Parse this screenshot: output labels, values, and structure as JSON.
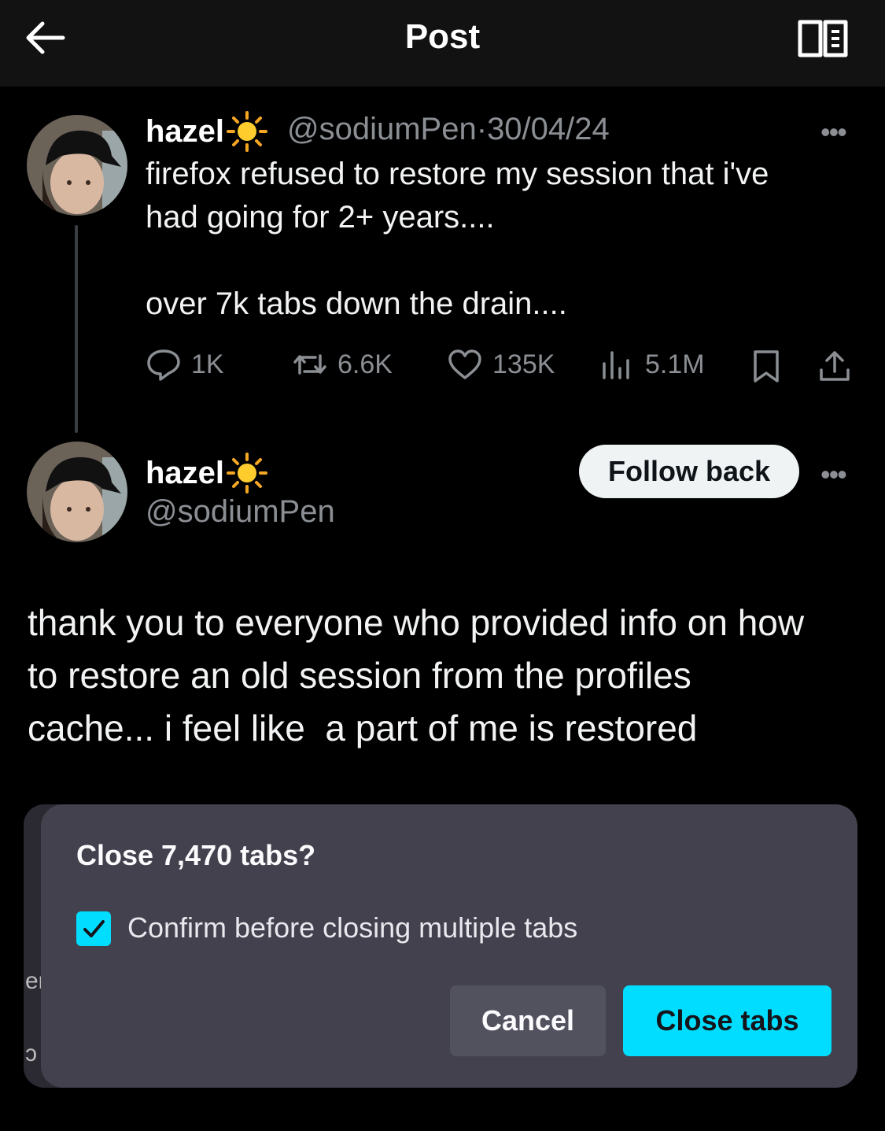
{
  "header": {
    "title": "Post",
    "back_icon": "back-arrow-icon",
    "reader_icon": "reader-mode-icon"
  },
  "colors": {
    "background": "#000000",
    "header": "#121212",
    "secondary_text": "#8b8f94",
    "dialog_bg": "#42414d",
    "accent": "#00ddff"
  },
  "tweet": {
    "name": "hazel",
    "emoji": "sun-icon",
    "handle": "@sodiumPen",
    "separator": "·",
    "date": "30/04/24",
    "more": "•••",
    "line1": "firefox refused to restore my session that i've",
    "line2": "had going for 2+ years....",
    "line3": "over 7k tabs down the drain....",
    "actions": {
      "replies": "1K",
      "reposts": "6.6K",
      "likes": "135K",
      "views": "5.1M"
    }
  },
  "reply": {
    "name": "hazel",
    "emoji": "sun-icon",
    "handle": "@sodiumPen",
    "follow_label": "Follow back",
    "more": "•••",
    "line1": "thank you to everyone who provided info on how",
    "line2": "to restore an old session from the profiles",
    "line3": "cache... i feel like  a part of me is restored"
  },
  "dialog": {
    "title": "Close 7,470 tabs?",
    "checkbox_label": "Confirm before closing multiple tabs",
    "checkbox_checked": true,
    "cancel_label": "Cancel",
    "confirm_label": "Close tabs",
    "edge_text_1": "er",
    "edge_text_2": "ɔ"
  }
}
